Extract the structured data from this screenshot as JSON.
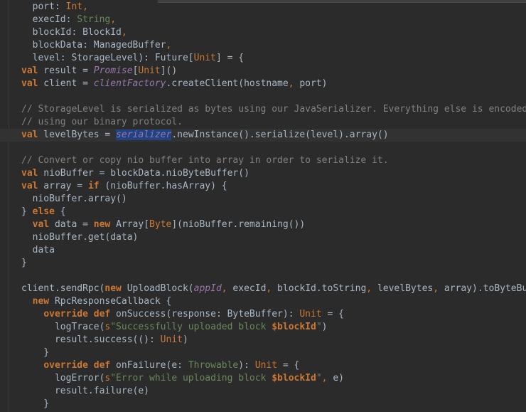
{
  "editor": {
    "lines": [
      {
        "segments": [
          {
            "t": "  port: ",
            "c": "ident"
          },
          {
            "t": "Int",
            "c": "op"
          },
          {
            "t": ",",
            "c": "op"
          }
        ]
      },
      {
        "segments": [
          {
            "t": "  execId: ",
            "c": "ident"
          },
          {
            "t": "String",
            "c": "ty"
          },
          {
            "t": ",",
            "c": "op"
          }
        ]
      },
      {
        "segments": [
          {
            "t": "  blockId: BlockId",
            "c": "ident"
          },
          {
            "t": ",",
            "c": "op"
          }
        ]
      },
      {
        "segments": [
          {
            "t": "  blockData: ManagedBuffer",
            "c": "ident"
          },
          {
            "t": ",",
            "c": "op"
          }
        ]
      },
      {
        "segments": [
          {
            "t": "  level: StorageLevel): Future[",
            "c": "ident"
          },
          {
            "t": "Unit",
            "c": "op"
          },
          {
            "t": "] = {",
            "c": "ident"
          }
        ]
      },
      {
        "segments": [
          {
            "t": "val",
            "c": "kw"
          },
          {
            "t": " result = ",
            "c": "ident"
          },
          {
            "t": "Promise",
            "c": "it"
          },
          {
            "t": "[",
            "c": "ident"
          },
          {
            "t": "Unit",
            "c": "op"
          },
          {
            "t": "]()",
            "c": "ident"
          }
        ]
      },
      {
        "segments": [
          {
            "t": "val",
            "c": "kw"
          },
          {
            "t": " client = ",
            "c": "ident"
          },
          {
            "t": "clientFactory",
            "c": "fld"
          },
          {
            "t": ".createClient(hostname",
            "c": "ident"
          },
          {
            "t": ",",
            "c": "op"
          },
          {
            "t": " port)",
            "c": "ident"
          }
        ]
      },
      {
        "segments": [
          {
            "t": "",
            "c": "ident"
          }
        ]
      },
      {
        "segments": [
          {
            "t": "// StorageLevel is serialized as bytes using our JavaSerializer. Everything else is encoded",
            "c": "cm"
          }
        ]
      },
      {
        "segments": [
          {
            "t": "// using our binary protocol.",
            "c": "cm"
          }
        ]
      },
      {
        "current": true,
        "segments": [
          {
            "t": "val",
            "c": "kw"
          },
          {
            "t": " levelBytes = ",
            "c": "ident"
          },
          {
            "t": "serializer",
            "c": "fld hl"
          },
          {
            "t": ".newInstance().serialize(level).array()",
            "c": "ident"
          }
        ]
      },
      {
        "segments": [
          {
            "t": "",
            "c": "ident"
          }
        ]
      },
      {
        "segments": [
          {
            "t": "// Convert or copy nio buffer into array in order to serialize it.",
            "c": "cm"
          }
        ]
      },
      {
        "segments": [
          {
            "t": "val",
            "c": "kw"
          },
          {
            "t": " nioBuffer = blockData.nioByteBuffer()",
            "c": "ident"
          }
        ]
      },
      {
        "segments": [
          {
            "t": "val",
            "c": "kw"
          },
          {
            "t": " array = ",
            "c": "ident"
          },
          {
            "t": "if",
            "c": "kw"
          },
          {
            "t": " (nioBuffer.hasArray) {",
            "c": "ident"
          }
        ]
      },
      {
        "segments": [
          {
            "t": "  nioBuffer.array()",
            "c": "ident"
          }
        ]
      },
      {
        "segments": [
          {
            "t": "} ",
            "c": "ident"
          },
          {
            "t": "else",
            "c": "kw"
          },
          {
            "t": " {",
            "c": "ident"
          }
        ]
      },
      {
        "segments": [
          {
            "t": "  ",
            "c": "ident"
          },
          {
            "t": "val",
            "c": "kw"
          },
          {
            "t": " data = ",
            "c": "ident"
          },
          {
            "t": "new",
            "c": "kw"
          },
          {
            "t": " Array[",
            "c": "ident"
          },
          {
            "t": "Byte",
            "c": "op"
          },
          {
            "t": "](nioBuffer.remaining())",
            "c": "ident"
          }
        ]
      },
      {
        "segments": [
          {
            "t": "  nioBuffer.get(data)",
            "c": "ident"
          }
        ]
      },
      {
        "segments": [
          {
            "t": "  data",
            "c": "ident"
          }
        ]
      },
      {
        "segments": [
          {
            "t": "}",
            "c": "ident"
          }
        ]
      },
      {
        "segments": [
          {
            "t": "",
            "c": "ident"
          }
        ]
      },
      {
        "segments": [
          {
            "t": "client.sendRpc(",
            "c": "ident"
          },
          {
            "t": "new",
            "c": "kw"
          },
          {
            "t": " UploadBlock(",
            "c": "ident"
          },
          {
            "t": "appId",
            "c": "fld"
          },
          {
            "t": ",",
            "c": "op"
          },
          {
            "t": " execId",
            "c": "ident"
          },
          {
            "t": ",",
            "c": "op"
          },
          {
            "t": " blockId.toString",
            "c": "ident"
          },
          {
            "t": ",",
            "c": "op"
          },
          {
            "t": " levelBytes",
            "c": "ident"
          },
          {
            "t": ",",
            "c": "op"
          },
          {
            "t": " array).toByteBuffer",
            "c": "ident"
          }
        ]
      },
      {
        "segments": [
          {
            "t": "  ",
            "c": "ident"
          },
          {
            "t": "new",
            "c": "kw"
          },
          {
            "t": " RpcResponseCallback {",
            "c": "ident"
          }
        ]
      },
      {
        "segments": [
          {
            "t": "    ",
            "c": "ident"
          },
          {
            "t": "override def",
            "c": "kw"
          },
          {
            "t": " onSuccess(response: ByteBuffer): ",
            "c": "ident"
          },
          {
            "t": "Unit",
            "c": "op"
          },
          {
            "t": " = {",
            "c": "ident"
          }
        ]
      },
      {
        "segments": [
          {
            "t": "      logTrace(",
            "c": "ident"
          },
          {
            "t": "s",
            "c": "op"
          },
          {
            "t": "\"Successfully uploaded block ",
            "c": "str"
          },
          {
            "t": "$blockId",
            "c": "interp"
          },
          {
            "t": "\"",
            "c": "str"
          },
          {
            "t": ")",
            "c": "ident"
          }
        ]
      },
      {
        "segments": [
          {
            "t": "      result.success(()",
            "c": "ident"
          },
          {
            "t": ": ",
            "c": "ident"
          },
          {
            "t": "Unit",
            "c": "op"
          },
          {
            "t": ")",
            "c": "ident"
          }
        ]
      },
      {
        "segments": [
          {
            "t": "    }",
            "c": "ident"
          }
        ]
      },
      {
        "segments": [
          {
            "t": "    ",
            "c": "ident"
          },
          {
            "t": "override def",
            "c": "kw"
          },
          {
            "t": " onFailure(e: ",
            "c": "ident"
          },
          {
            "t": "Throwable",
            "c": "ty"
          },
          {
            "t": "): ",
            "c": "ident"
          },
          {
            "t": "Unit",
            "c": "op"
          },
          {
            "t": " = {",
            "c": "ident"
          }
        ]
      },
      {
        "segments": [
          {
            "t": "      logError(",
            "c": "ident"
          },
          {
            "t": "s",
            "c": "op"
          },
          {
            "t": "\"Error while uploading block ",
            "c": "str"
          },
          {
            "t": "$blockId",
            "c": "interp"
          },
          {
            "t": "\"",
            "c": "str"
          },
          {
            "t": ",",
            "c": "op"
          },
          {
            "t": " e)",
            "c": "ident"
          }
        ]
      },
      {
        "segments": [
          {
            "t": "      result.failure(e)",
            "c": "ident"
          }
        ]
      },
      {
        "segments": [
          {
            "t": "    }",
            "c": "ident"
          }
        ]
      }
    ]
  },
  "colors": {
    "background": "#2b2b2b",
    "keyword": "#cc7832",
    "comment": "#808080",
    "string": "#6a8759",
    "field": "#9876aa",
    "selection": "#214283"
  }
}
